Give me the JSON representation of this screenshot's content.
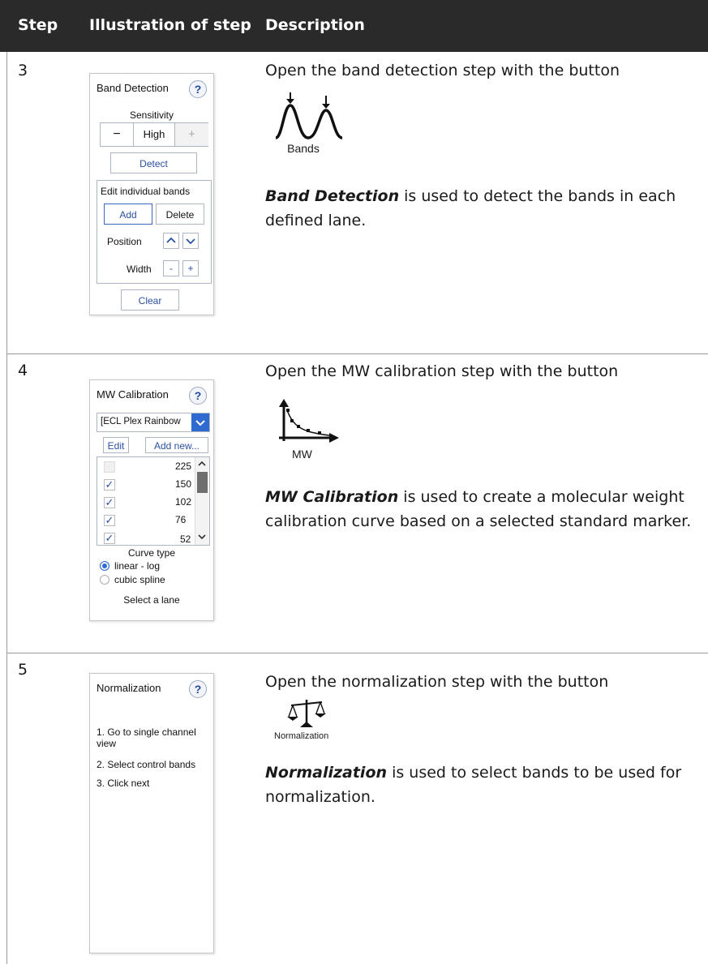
{
  "header": {
    "col_step": "Step",
    "col_illustration": "Illustration of step",
    "col_description": "Description"
  },
  "rows": [
    {
      "step": "3",
      "intro": "Open the band detection step with the button",
      "icon_caption": "Bands",
      "desc_bold": "Band Detection",
      "desc_rest": " is used to detect the bands in each defined lane.",
      "panel": {
        "title": "Band Detection",
        "help": "?",
        "sensitivity_label": "Sensitivity",
        "minus": "−",
        "sensitivity_value": "High",
        "plus": "+",
        "detect": "Detect",
        "edit_label": "Edit individual bands",
        "add": "Add",
        "delete": "Delete",
        "position_label": "Position",
        "width_label": "Width",
        "width_minus": "-",
        "width_plus": "+",
        "clear": "Clear"
      }
    },
    {
      "step": "4",
      "intro": "Open the MW calibration step with the button",
      "icon_caption": "MW",
      "desc_bold": "MW Calibration",
      "desc_rest": " is used to create a molecular weight calibration curve based on a selected standard marker.",
      "panel": {
        "title": "MW Calibration",
        "help": "?",
        "marker_select": "[ECL Plex Rainbow",
        "edit": "Edit",
        "add_new": "Add new...",
        "weights": [
          {
            "value": "225",
            "checked": false
          },
          {
            "value": "150",
            "checked": true
          },
          {
            "value": "102",
            "checked": true
          },
          {
            "value": "76",
            "checked": true
          },
          {
            "value": "52",
            "checked": true
          }
        ],
        "check_glyph": "✓",
        "curve_type_label": "Curve type",
        "curve_options": [
          "linear - log",
          "cubic spline"
        ],
        "selected_curve": "linear - log",
        "hint": "Select a lane"
      }
    },
    {
      "step": "5",
      "intro": "Open the normalization step with the button",
      "icon_caption": "Normalization",
      "desc_bold": "Normalization",
      "desc_rest": " is used to select bands to be used for normalization.",
      "panel": {
        "title": "Normalization",
        "help": "?",
        "instructions": [
          "1. Go to single channel view",
          "2. Select control bands",
          "3. Click next"
        ]
      }
    }
  ],
  "icons": {
    "help": "help-icon",
    "bands": "bands-icon",
    "mw": "mw-calibration-icon",
    "normalization": "scale-icon",
    "arrow_up": "chevron-up-icon",
    "arrow_down": "chevron-down-icon"
  },
  "colors": {
    "header_bg": "#2a2a2a",
    "accent_blue": "#2b50a0",
    "dropdown_blue": "#2f6ad0"
  }
}
